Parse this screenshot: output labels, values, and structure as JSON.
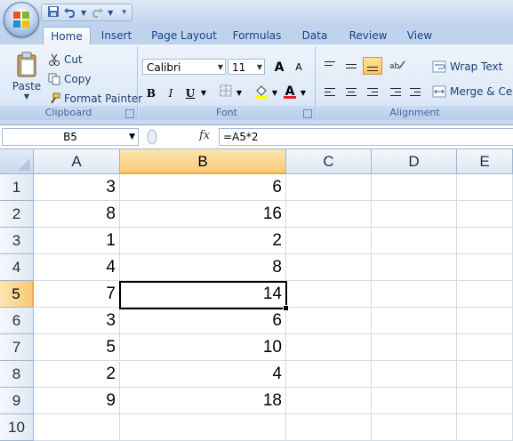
{
  "ribbon": {
    "tabs": [
      "Home",
      "Insert",
      "Page Layout",
      "Formulas",
      "Data",
      "Review",
      "View"
    ],
    "active_tab": "Home",
    "clipboard": {
      "paste": "Paste",
      "cut": "Cut",
      "copy": "Copy",
      "format_painter": "Format Painter",
      "group_label": "Clipboard"
    },
    "font": {
      "name": "Calibri",
      "size": "11",
      "bold": "B",
      "italic": "I",
      "underline": "U",
      "group_label": "Font",
      "grow": "A",
      "shrink": "A",
      "font_color_glyph": "A"
    },
    "alignment": {
      "wrap_text": "Wrap Text",
      "merge_center": "Merge & Center",
      "group_label": "Alignment"
    }
  },
  "colors": {
    "accent": "#15428b",
    "selected_header": "#f9c977",
    "font_color": "#e02020",
    "highlight_color": "#ffff00"
  },
  "formula_bar": {
    "name_box": "B5",
    "fx": "fx",
    "formula": "=A5*2"
  },
  "sheet": {
    "columns": [
      "A",
      "B",
      "C",
      "D",
      "E"
    ],
    "selected_column": "B",
    "rows": [
      {
        "num": "1",
        "A": "3",
        "B": "6"
      },
      {
        "num": "2",
        "A": "8",
        "B": "16"
      },
      {
        "num": "3",
        "A": "1",
        "B": "2"
      },
      {
        "num": "4",
        "A": "4",
        "B": "8"
      },
      {
        "num": "5",
        "A": "7",
        "B": "14"
      },
      {
        "num": "6",
        "A": "3",
        "B": "6"
      },
      {
        "num": "7",
        "A": "5",
        "B": "10"
      },
      {
        "num": "8",
        "A": "2",
        "B": "4"
      },
      {
        "num": "9",
        "A": "9",
        "B": "18"
      },
      {
        "num": "10",
        "A": "",
        "B": ""
      }
    ],
    "selected_row": "5",
    "active_cell": "B5"
  }
}
